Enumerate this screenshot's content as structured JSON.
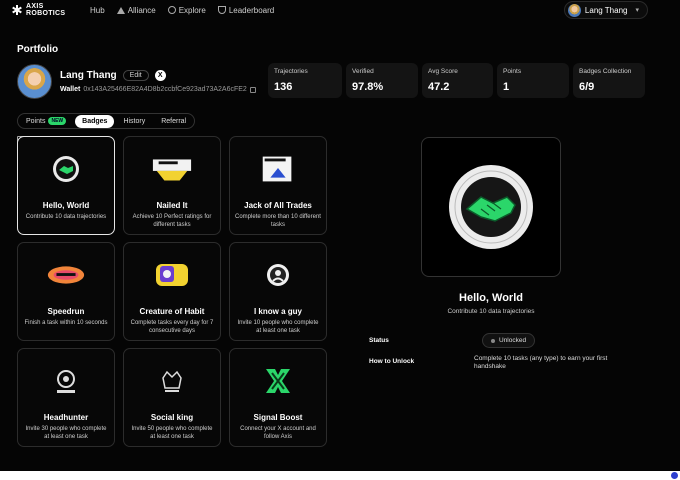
{
  "brand": {
    "line1": "AXIS",
    "line2": "ROBOTICS"
  },
  "nav": [
    {
      "label": "Hub",
      "icon": "grid-icon"
    },
    {
      "label": "Alliance",
      "icon": "triangle-icon"
    },
    {
      "label": "Explore",
      "icon": "compass-icon"
    },
    {
      "label": "Leaderboard",
      "icon": "trophy-icon"
    }
  ],
  "header_user": {
    "name": "Lang Thang"
  },
  "page": {
    "title": "Portfolio"
  },
  "profile": {
    "name": "Lang Thang",
    "edit_label": "Edit",
    "x_label": "X",
    "wallet_label": "Wallet",
    "wallet": "0x143A25466E82A4D8b2ccbfCe923ad73A2A6cFE2"
  },
  "stats": [
    {
      "label": "Trajectories",
      "value": "136"
    },
    {
      "label": "Verified",
      "value": "97.8%"
    },
    {
      "label": "Avg Score",
      "value": "47.2"
    },
    {
      "label": "Points",
      "value": "1"
    },
    {
      "label": "Badges Collection",
      "value": "6/9"
    }
  ],
  "tabs": [
    {
      "label": "Points",
      "badge": "NEW"
    },
    {
      "label": "Badges"
    },
    {
      "label": "History"
    },
    {
      "label": "Referral"
    }
  ],
  "badges": [
    {
      "title": "Hello, World",
      "desc": "Contribute 10 data trajectories",
      "icon": "handshake-badge-icon"
    },
    {
      "title": "Nailed It",
      "desc": "Achieve 10 Perfect ratings for different tasks",
      "icon": "nailed-it-badge-icon"
    },
    {
      "title": "Jack of All Trades",
      "desc": "Complete more than 10 different tasks",
      "icon": "jack-of-all-trades-badge-icon"
    },
    {
      "title": "Speedrun",
      "desc": "Finish a task within 10 seconds",
      "icon": "speedrun-badge-icon"
    },
    {
      "title": "Creature of Habit",
      "desc": "Complete tasks every day for 7 consecutive days",
      "icon": "creature-of-habit-badge-icon"
    },
    {
      "title": "I know a guy",
      "desc": "Invite 10 people who complete at least one task",
      "icon": "i-know-a-guy-badge-icon"
    },
    {
      "title": "Headhunter",
      "desc": "Invite 30 people who complete at least one task",
      "icon": "headhunter-badge-icon"
    },
    {
      "title": "Social king",
      "desc": "Invite 50 people who complete at least one task",
      "icon": "social-king-badge-icon"
    },
    {
      "title": "Signal Boost",
      "desc": "Connect your X account and follow Axis",
      "icon": "signal-boost-badge-icon"
    }
  ],
  "detail": {
    "title": "Hello, World",
    "desc": "Contribute 10 data trajectories",
    "status_label": "Status",
    "status_value": "Unlocked",
    "unlock_label": "How to Unlock",
    "unlock_text": "Complete 10 tasks (any type) to earn your first handshake"
  },
  "colors": {
    "accent": "#2bd66a",
    "background": "#050505",
    "card_border": "#2c2c2c"
  }
}
